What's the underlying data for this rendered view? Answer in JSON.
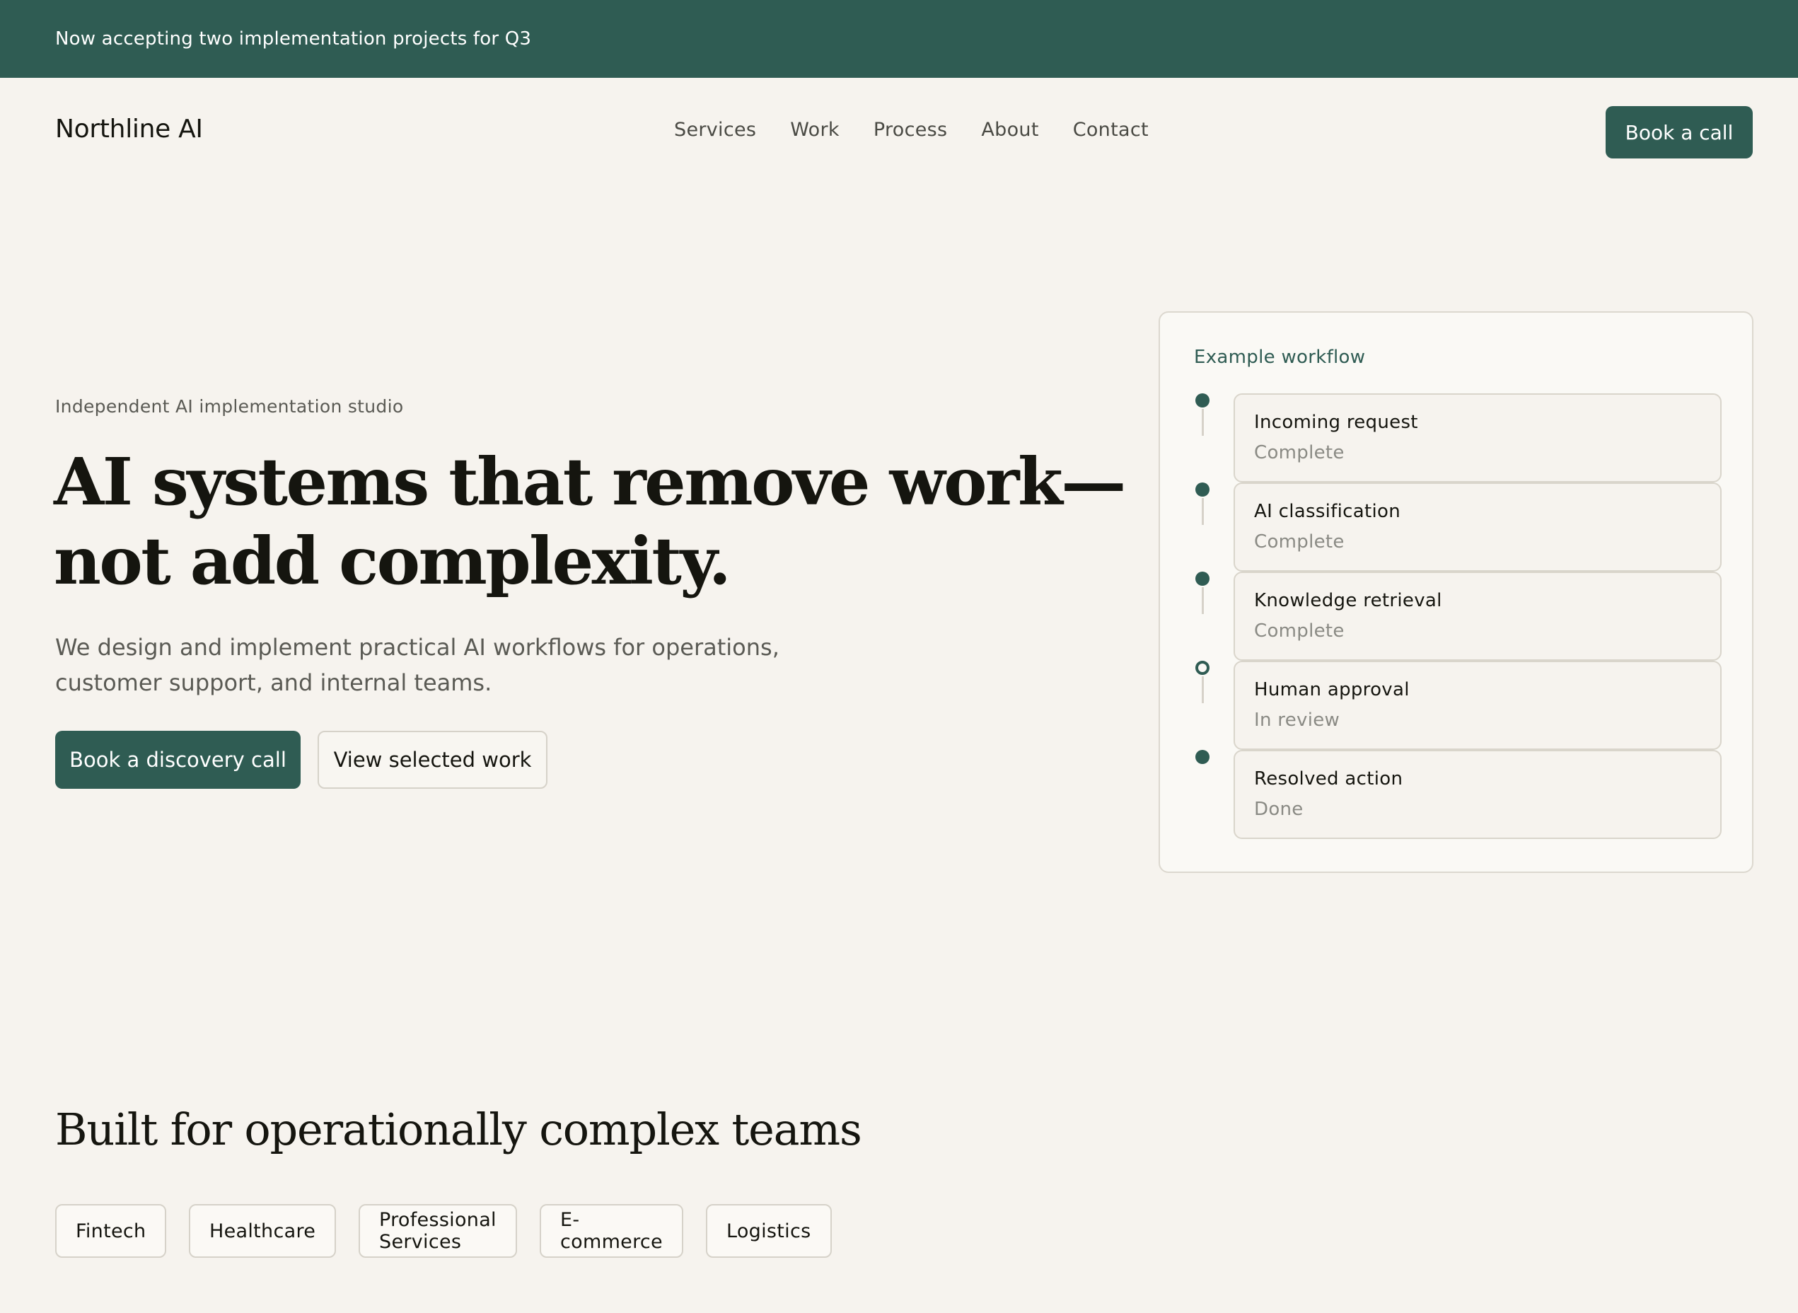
{
  "announcement": {
    "text": "Now accepting two implementation projects for Q3"
  },
  "nav": {
    "brand": "Northline AI",
    "links": [
      {
        "label": "Services"
      },
      {
        "label": "Work"
      },
      {
        "label": "Process"
      },
      {
        "label": "About"
      },
      {
        "label": "Contact"
      }
    ],
    "cta": "Book a call"
  },
  "hero": {
    "eyebrow": "Independent AI implementation studio",
    "headline_line1": "AI systems that remove work—",
    "headline_line2": "not add complexity.",
    "lede": "We design and implement practical AI workflows for operations, customer support, and internal teams.",
    "primary_cta": "Book a discovery call",
    "secondary_cta": "View selected work"
  },
  "workflow": {
    "title": "Example workflow",
    "steps": [
      {
        "name": "Incoming request",
        "status": "Complete",
        "state": "done"
      },
      {
        "name": "AI classification",
        "status": "Complete",
        "state": "done"
      },
      {
        "name": "Knowledge retrieval",
        "status": "Complete",
        "state": "done"
      },
      {
        "name": "Human approval",
        "status": "In review",
        "state": "pending"
      },
      {
        "name": "Resolved action",
        "status": "Done",
        "state": "done"
      }
    ]
  },
  "industries": {
    "title": "Built for operationally complex teams",
    "items": [
      "Fintech",
      "Healthcare",
      "Professional Services",
      "E-commerce",
      "Logistics"
    ]
  },
  "colors": {
    "brand": "#2f5c53",
    "background": "#f6f3ee",
    "card": "#faf9f5",
    "border": "#d6d2c9",
    "muted_text": "#5a5a54"
  }
}
